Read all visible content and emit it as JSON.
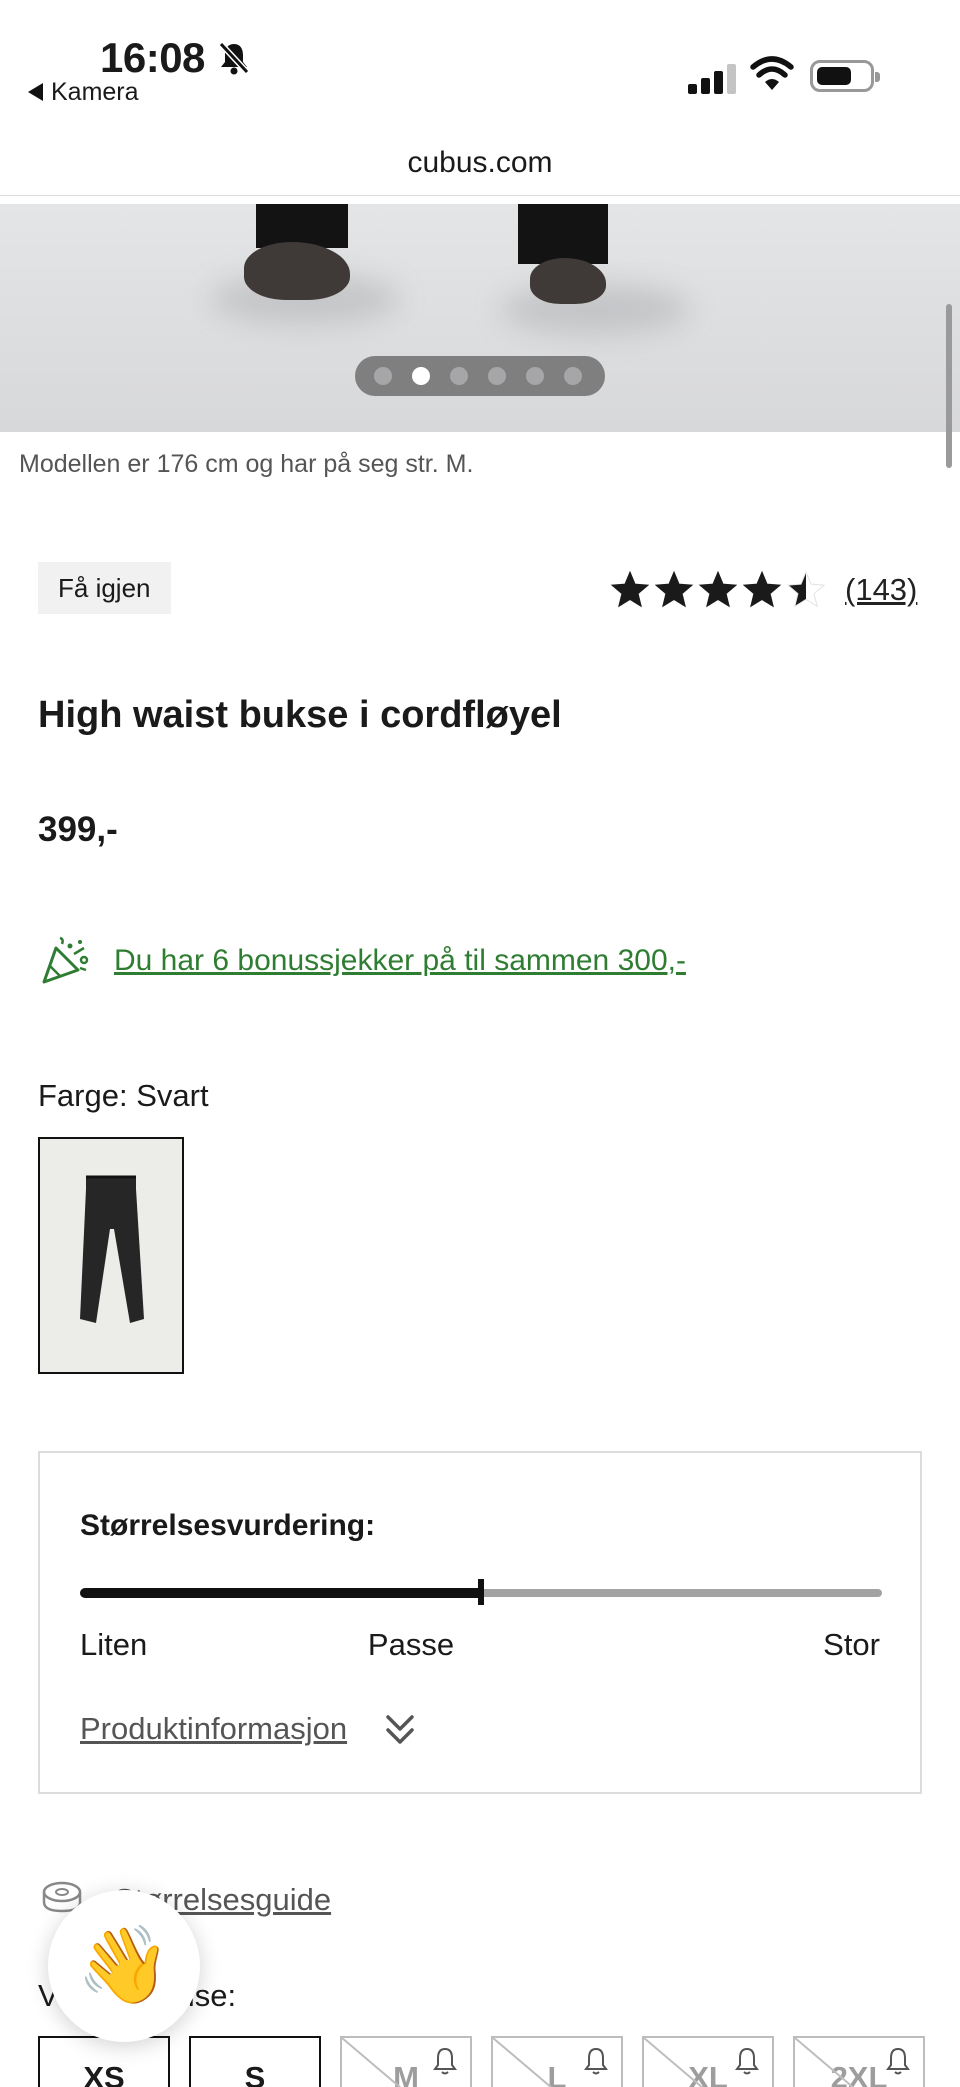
{
  "status_bar": {
    "time": "16:08",
    "back_app": "Kamera"
  },
  "browser": {
    "url": "cubus.com"
  },
  "gallery": {
    "total_images": 6,
    "active_index": 1,
    "caption": "Modellen er 176 cm og har på seg str. M."
  },
  "product": {
    "badge": "Få igjen",
    "rating": 4.5,
    "review_count": "(143)",
    "title": "High waist bukse i cordfløyel",
    "price": "399,-",
    "bonus_text": "Du har 6 bonussjekker på til sammen 300,-",
    "color_label": "Farge: Svart"
  },
  "size_rating": {
    "title": "Størrelsesvurdering:",
    "value_fraction": 0.5,
    "label_left": "Liten",
    "label_mid": "Passe",
    "label_right": "Stor",
    "product_info_link": "Produktinformasjon"
  },
  "size_section": {
    "guide_link": "Størrelsesguide",
    "choose_label": "Velg størrelse:",
    "sizes": [
      {
        "label": "XS",
        "available": true
      },
      {
        "label": "S",
        "available": true
      },
      {
        "label": "M",
        "available": false
      },
      {
        "label": "L",
        "available": false
      },
      {
        "label": "XL",
        "available": false
      },
      {
        "label": "2XL",
        "available": false
      }
    ]
  },
  "colors": {
    "accent_green": "#2f7d32",
    "text": "#1a1a1a",
    "muted": "#555555"
  },
  "icons": {
    "bonus": "party-popper-icon",
    "guide": "measuring-tape-icon",
    "chat": "waving-hand-icon"
  }
}
